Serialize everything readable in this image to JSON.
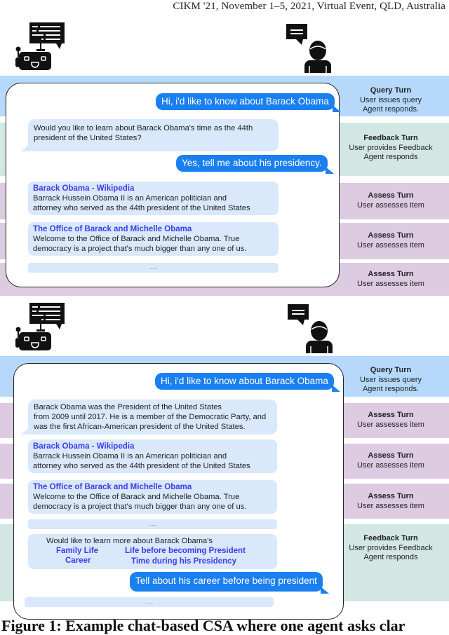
{
  "header": {
    "venue": "CIKM '21, November 1–5, 2021, Virtual Event, QLD, Australia"
  },
  "icons": {
    "agent": "robot-with-speech-bubble-icon",
    "user": "person-with-speech-bubble-icon"
  },
  "colors": {
    "query_band": "#b5d8fb",
    "feedback_band": "#d2e6e4",
    "assess_band": "#ddcbe2",
    "user_bubble": "#1a7ff0",
    "agent_bubble": "#dae8fb",
    "link": "#3b3bf0"
  },
  "top": {
    "turns": [
      {
        "type": "query",
        "title": "Query Turn",
        "lines": [
          "User issues query",
          "Agent responds."
        ]
      },
      {
        "type": "feedback",
        "title": "Feedback Turn",
        "lines": [
          "User provides Feedback",
          "Agent responds"
        ]
      },
      {
        "type": "assess",
        "title": "Assess Turn",
        "lines": [
          "User assesses item"
        ]
      },
      {
        "type": "assess",
        "title": "Assess Turn",
        "lines": [
          "User assesses item"
        ]
      },
      {
        "type": "assess",
        "title": "Assess Turn",
        "lines": [
          "User assesses item"
        ]
      }
    ],
    "messages": {
      "user_query": "Hi, i'd like to know about Barack Obama",
      "agent_clarify": [
        "Would you like to learn about Barack Obama's time as the 44th",
        "president of the United States?"
      ],
      "user_feedback": "Yes, tell me about his presidency.",
      "results": [
        {
          "title": "Barack Obama - Wikipedia",
          "lines": [
            "Barrack Hussein Obama II is an American politician and",
            "attorney who served as the 44th president of the United States"
          ]
        },
        {
          "title": "The Office of Barack and Michelle Obama",
          "lines": [
            "Welcome to the Office of Barack and Michelle Obama. True",
            "democracy is a project that's much bigger than any one of us."
          ]
        }
      ],
      "more": "....."
    }
  },
  "bottom": {
    "turns": [
      {
        "type": "query",
        "title": "Query Turn",
        "lines": [
          "User issues query",
          "Agent responds."
        ]
      },
      {
        "type": "assess",
        "title": "Assess Turn",
        "lines": [
          "User assesses item"
        ]
      },
      {
        "type": "assess",
        "title": "Assess Turn",
        "lines": [
          "User assesses item"
        ]
      },
      {
        "type": "assess",
        "title": "Assess Turn",
        "lines": [
          "User assesses item"
        ]
      },
      {
        "type": "feedback",
        "title": "Feedback Turn",
        "lines": [
          "User provides Feedback",
          "Agent responds"
        ]
      }
    ],
    "messages": {
      "user_query": "Hi, i'd like to know about Barack Obama",
      "agent_answer": [
        "Barack Obama was the President of the United States",
        "from 2009 until 2017. He is a member of the Democratic Party, and",
        "was the first African-American president of the United States."
      ],
      "results": [
        {
          "title": "Barack Obama - Wikipedia",
          "lines": [
            "Barrack Hussein Obama II is an American politician and",
            "attorney who served as the 44th president of the United States"
          ]
        },
        {
          "title": "The Office of Barack and Michelle Obama",
          "lines": [
            "Welcome to the Office of Barack and Michelle Obama. True",
            "democracy is a project that's much bigger than any one of us."
          ]
        }
      ],
      "more": ".....",
      "clarify_prompt": "Would like to learn more about Barack Obama's",
      "clarify_options": [
        "Family Life",
        "Career",
        "Life before becoming President",
        "Time during his Presidency"
      ],
      "user_feedback": "Tell about his career before being president",
      "more2": "....."
    }
  },
  "caption": "Figure 1: Example chat-based CSA where one agent asks clar"
}
